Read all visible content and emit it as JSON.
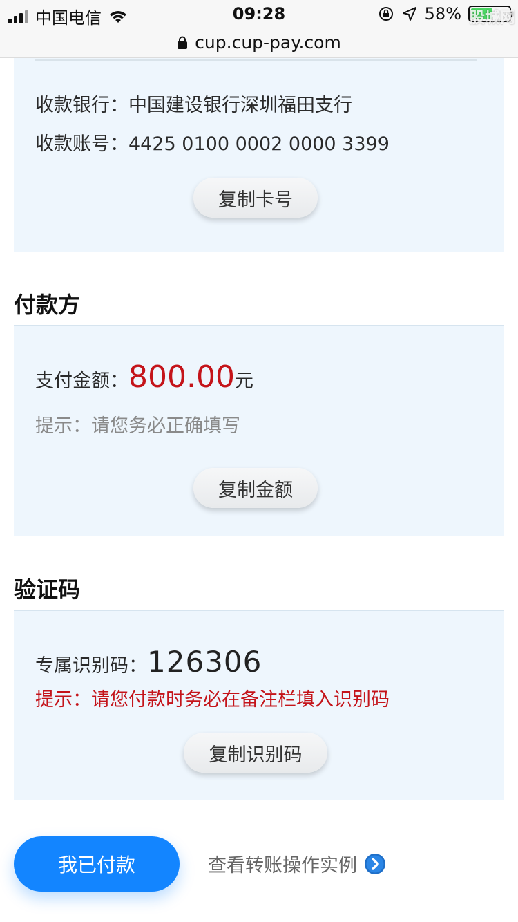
{
  "status_bar": {
    "carrier": "中国电信",
    "time": "09:28",
    "battery": "58%",
    "battery_level": 0.58,
    "watermark": "股城网"
  },
  "url_bar": {
    "url": "cup.cup-pay.com"
  },
  "payee": {
    "bank_label": "收款银行：",
    "bank_value": "中国建设银行深圳福田支行",
    "account_label": "收款账号：",
    "account_value": "4425 0100 0002 0000 3399",
    "copy_button": "复制卡号"
  },
  "payer": {
    "title": "付款方",
    "amount_label": "支付金额：",
    "amount_value": "800.00",
    "amount_unit": "元",
    "hint": "提示：请您务必正确填写",
    "copy_button": "复制金额"
  },
  "verify": {
    "title": "验证码",
    "code_label": "专属识别码：",
    "code_value": "126306",
    "hint": "提示：请您付款时务必在备注栏填入识别码",
    "copy_button": "复制识别码"
  },
  "footer": {
    "paid_button": "我已付款",
    "example_link": "查看转账操作实例"
  },
  "colors": {
    "accent": "#1385ff",
    "amount_red": "#c4141a",
    "panel_bg": "#eef6fd"
  }
}
